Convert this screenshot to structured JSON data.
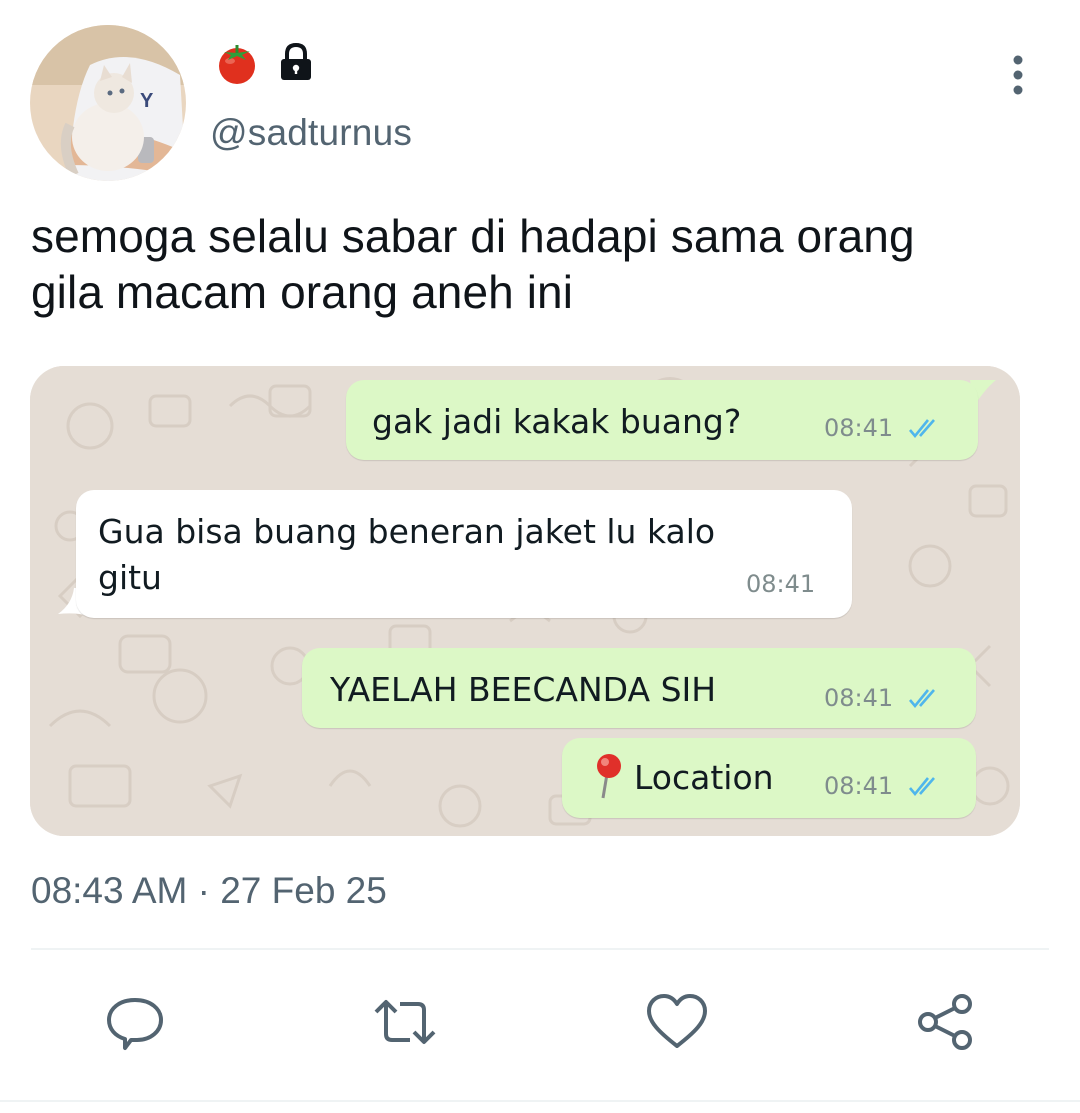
{
  "author": {
    "handle": "@sadturnus",
    "name_icons": [
      "tomato-emoji",
      "lock-icon"
    ]
  },
  "tweet": {
    "text_line1": "semoga selalu sabar di hadapi sama orang",
    "text_line2": "gila macam orang aneh ini",
    "posted_at": "08:43 AM · 27 Feb 25"
  },
  "chat": {
    "messages": [
      {
        "direction": "outgoing",
        "text": "gak jadi kakak buang?",
        "time": "08:41",
        "status": "read"
      },
      {
        "direction": "incoming",
        "text_line1": "Gua bisa buang beneran jaket lu kalo",
        "text_line2": "gitu",
        "time": "08:41"
      },
      {
        "direction": "outgoing",
        "text": "YAELAH BEECANDA SIH",
        "time": "08:41",
        "status": "read"
      },
      {
        "direction": "outgoing",
        "text": "Location",
        "icon": "location-pin-icon",
        "time": "08:41",
        "status": "read"
      }
    ]
  },
  "actions": [
    "reply-icon",
    "retweet-icon",
    "like-icon",
    "share-icon"
  ],
  "colors": {
    "secondary_text": "#536471",
    "outgoing_bubble": "#dcf8c6",
    "incoming_bubble": "#ffffff",
    "chat_wallpaper": "#e5ddd5",
    "read_ticks": "#4fb6ec"
  }
}
